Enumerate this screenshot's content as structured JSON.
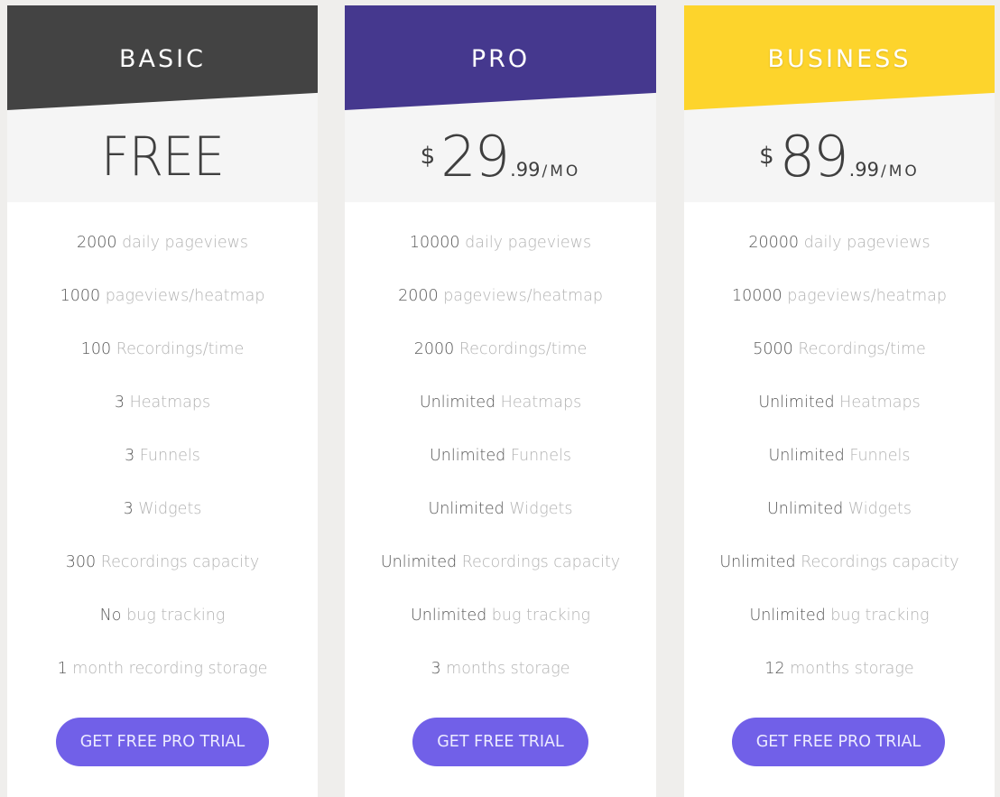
{
  "colors": {
    "background": "#efeeec",
    "basic_header": "#434343",
    "pro_header": "#45388e",
    "business_header": "#fdd42c",
    "price_area": "#f5f5f5",
    "cta_button": "#7160e8",
    "feature_qty": "#5a5a5a",
    "feature_label": "#b3b3b3"
  },
  "plans": [
    {
      "name": "BASIC",
      "price": {
        "free_label": "FREE"
      },
      "features": [
        {
          "qty": "2000",
          "label": "daily pageviews"
        },
        {
          "qty": "1000",
          "label": "pageviews/heatmap"
        },
        {
          "qty": "100",
          "label": "Recordings/time"
        },
        {
          "qty": "3",
          "label": "Heatmaps"
        },
        {
          "qty": "3",
          "label": "Funnels"
        },
        {
          "qty": "3",
          "label": "Widgets"
        },
        {
          "qty": "300",
          "label": "Recordings capacity"
        },
        {
          "qty": "No",
          "label": "bug tracking"
        },
        {
          "qty": "1",
          "label": "month recording storage"
        }
      ],
      "cta_label": "GET FREE PRO TRIAL"
    },
    {
      "name": "PRO",
      "price": {
        "currency": "$",
        "amount": "29",
        "cents": ".99",
        "period": "/MO"
      },
      "features": [
        {
          "qty": "10000",
          "label": "daily pageviews"
        },
        {
          "qty": "2000",
          "label": "pageviews/heatmap"
        },
        {
          "qty": "2000",
          "label": "Recordings/time"
        },
        {
          "qty": "Unlimited",
          "label": "Heatmaps"
        },
        {
          "qty": "Unlimited",
          "label": "Funnels"
        },
        {
          "qty": "Unlimited",
          "label": "Widgets"
        },
        {
          "qty": "Unlimited",
          "label": "Recordings capacity"
        },
        {
          "qty": "Unlimited",
          "label": "bug tracking"
        },
        {
          "qty": "3",
          "label": "months storage"
        }
      ],
      "cta_label": "GET FREE TRIAL"
    },
    {
      "name": "BUSINESS",
      "price": {
        "currency": "$",
        "amount": "89",
        "cents": ".99",
        "period": "/MO"
      },
      "features": [
        {
          "qty": "20000",
          "label": "daily pageviews"
        },
        {
          "qty": "10000",
          "label": "pageviews/heatmap"
        },
        {
          "qty": "5000",
          "label": "Recordings/time"
        },
        {
          "qty": "Unlimited",
          "label": "Heatmaps"
        },
        {
          "qty": "Unlimited",
          "label": "Funnels"
        },
        {
          "qty": "Unlimited",
          "label": "Widgets"
        },
        {
          "qty": "Unlimited",
          "label": "Recordings capacity"
        },
        {
          "qty": "Unlimited",
          "label": "bug tracking"
        },
        {
          "qty": "12",
          "label": "months storage"
        }
      ],
      "cta_label": "GET FREE PRO TRIAL"
    }
  ]
}
